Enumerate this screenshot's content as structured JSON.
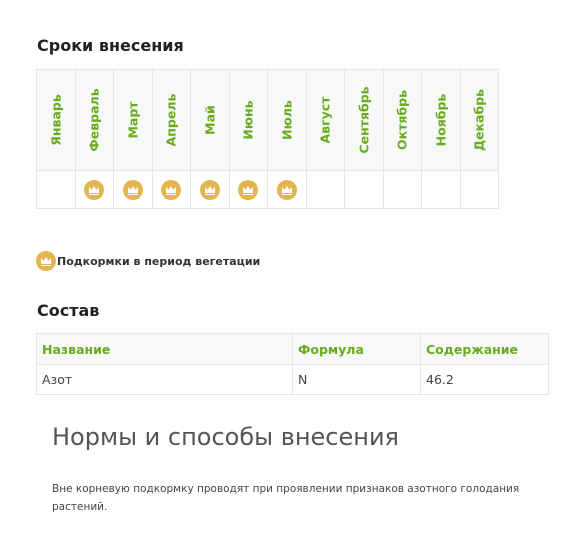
{
  "schedule": {
    "title": "Сроки внесения",
    "months": [
      {
        "name": "Январь",
        "active": false
      },
      {
        "name": "Февраль",
        "active": true
      },
      {
        "name": "Март",
        "active": true
      },
      {
        "name": "Апрель",
        "active": true
      },
      {
        "name": "Май",
        "active": true
      },
      {
        "name": "Июнь",
        "active": true
      },
      {
        "name": "Июль",
        "active": true
      },
      {
        "name": "Август",
        "active": false
      },
      {
        "name": "Сентябрь",
        "active": false
      },
      {
        "name": "Октябрь",
        "active": false
      },
      {
        "name": "Ноябрь",
        "active": false
      },
      {
        "name": "Декабрь",
        "active": false
      }
    ],
    "badge_icon": "crown-icon",
    "badge_color": "#e3b550",
    "label_color": "#6aaa1e"
  },
  "legend": {
    "icon": "crown-icon",
    "text": "Подкормки в период вегетации"
  },
  "composition": {
    "title": "Состав",
    "headers": [
      "Название",
      "Формула",
      "Содержание"
    ],
    "rows": [
      [
        "Азот",
        "N",
        "46.2"
      ]
    ]
  },
  "norms": {
    "title": "Нормы и способы внесения",
    "text": "Вне корневую подкормку проводят при проявлении признаков азотного голодания растений."
  }
}
